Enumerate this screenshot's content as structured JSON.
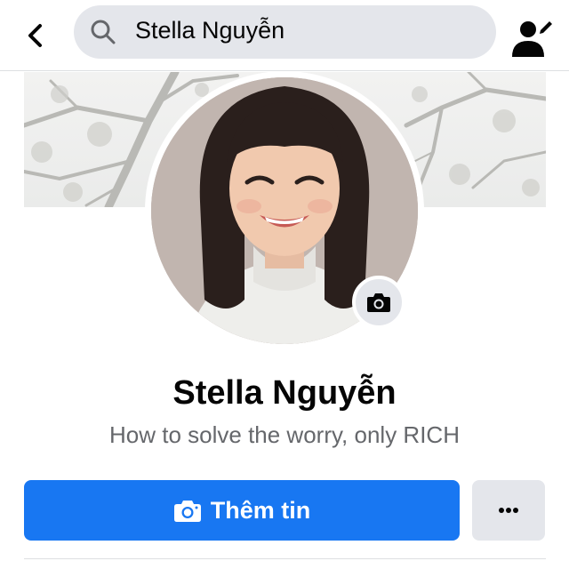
{
  "header": {
    "back_icon": "chevron-left-icon",
    "search_icon": "search-icon",
    "search_value": "Stella Nguyễn",
    "profile_icon": "user-edit-icon"
  },
  "cover": {
    "image": "tree-branches-photo"
  },
  "profile": {
    "avatar": "profile-photo",
    "camera_icon": "camera-icon",
    "name": "Stella Nguyễn",
    "bio": "How to solve the worry, only RICH"
  },
  "actions": {
    "primary_icon": "camera-icon",
    "primary_label": "Thêm tin",
    "primary_color": "#1877f2",
    "more_icon": "ellipsis-icon",
    "more_label": "..."
  }
}
